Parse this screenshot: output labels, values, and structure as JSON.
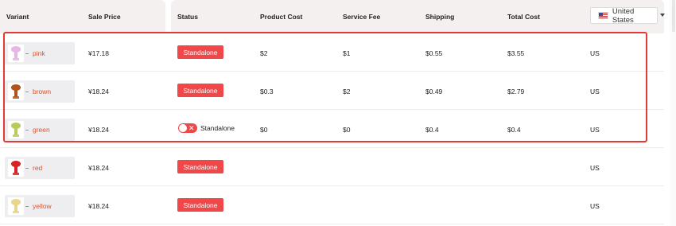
{
  "header": {
    "variant": "Variant",
    "sale_price": "Sale Price",
    "status": "Status",
    "product_cost": "Product Cost",
    "service_fee": "Service Fee",
    "shipping": "Shipping",
    "total_cost": "Total Cost",
    "country": "United States"
  },
  "rows": [
    {
      "name": "pink",
      "price": "¥17.18",
      "status": "Standalone",
      "status_kind": "badge",
      "product_cost": "$2",
      "service_fee": "$1",
      "shipping": "$0.55",
      "total_cost": "$3.55",
      "country": "US",
      "color": "#e7b6e6"
    },
    {
      "name": "brown",
      "price": "¥18.24",
      "status": "Standalone",
      "status_kind": "badge",
      "product_cost": "$0.3",
      "service_fee": "$2",
      "shipping": "$0.49",
      "total_cost": "$2.79",
      "country": "US",
      "color": "#b2531e"
    },
    {
      "name": "green",
      "price": "¥18.24",
      "status": "Standalone",
      "status_kind": "toggle",
      "product_cost": "$0",
      "service_fee": "$0",
      "shipping": "$0.4",
      "total_cost": "$0.4",
      "country": "US",
      "color": "#b9cb5a"
    },
    {
      "name": "red",
      "price": "¥18.24",
      "status": "Standalone",
      "status_kind": "badge",
      "product_cost": "",
      "service_fee": "",
      "shipping": "",
      "total_cost": "",
      "country": "US",
      "color": "#d72323"
    },
    {
      "name": "yellow",
      "price": "¥18.24",
      "status": "Standalone",
      "status_kind": "badge",
      "product_cost": "",
      "service_fee": "",
      "shipping": "",
      "total_cost": "",
      "country": "US",
      "color": "#e9d58c"
    }
  ],
  "colors": {
    "accent": "#f04848",
    "highlight": "#e53935",
    "variant_text": "#e0542c"
  }
}
